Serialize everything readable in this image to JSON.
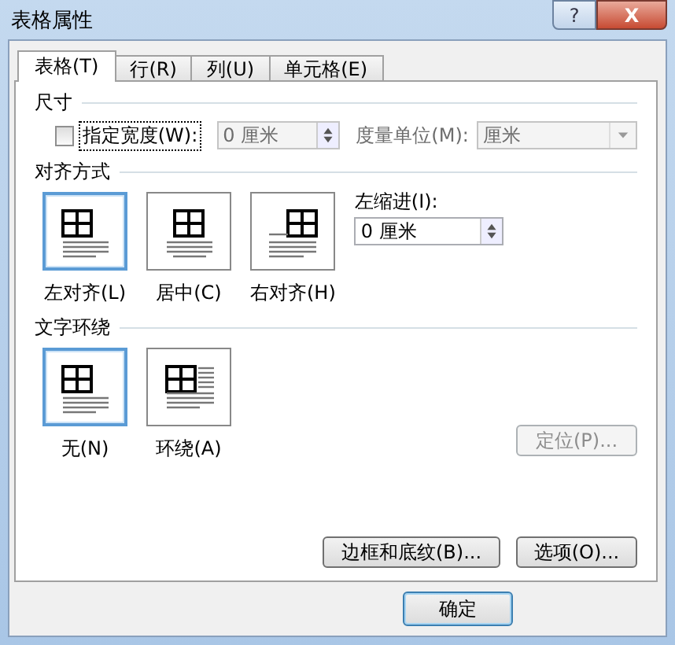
{
  "window": {
    "title": "表格属性",
    "help": "?",
    "close": "X"
  },
  "tabs": [
    {
      "label": "表格(T)",
      "selected": true
    },
    {
      "label": "行(R)",
      "selected": false
    },
    {
      "label": "列(U)",
      "selected": false
    },
    {
      "label": "单元格(E)",
      "selected": false
    }
  ],
  "size": {
    "heading": "尺寸",
    "preferred_width": {
      "label": "指定宽度(W):",
      "checked": false,
      "value": "0 厘米",
      "disabled": true
    },
    "measure_in": {
      "label": "度量单位(M):",
      "value": "厘米",
      "disabled": true
    }
  },
  "alignment": {
    "heading": "对齐方式",
    "options": [
      {
        "label": "左对齐(L)",
        "kind": "left",
        "selected": true
      },
      {
        "label": "居中(C)",
        "kind": "center",
        "selected": false
      },
      {
        "label": "右对齐(H)",
        "kind": "right",
        "selected": false
      }
    ],
    "indent": {
      "label": "左缩进(I):",
      "value": "0 厘米"
    }
  },
  "wrapping": {
    "heading": "文字环绕",
    "options": [
      {
        "label": "无(N)",
        "kind": "none",
        "selected": true
      },
      {
        "label": "环绕(A)",
        "kind": "around",
        "selected": false
      }
    ],
    "position_button": {
      "label": "定位(P)...",
      "disabled": true
    }
  },
  "buttons": [
    {
      "label": "边框和底纹(B)..."
    },
    {
      "label": "选项(O)..."
    }
  ],
  "footer": [
    {
      "label": "确定"
    }
  ]
}
